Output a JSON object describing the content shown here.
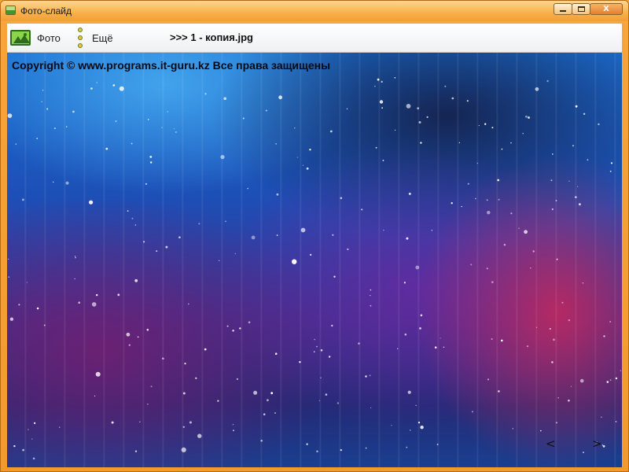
{
  "window": {
    "title": "Фото-слайд",
    "controls": {
      "close_label": "X"
    }
  },
  "toolbar": {
    "photo_label": "Фото",
    "more_label": "Ещё",
    "filename": ">>> 1 - копия.jpg"
  },
  "viewer": {
    "copyright": "Copyright © www.programs.it-guru.kz Все права защищены",
    "prev_label": "<",
    "next_label": ">"
  },
  "colors": {
    "frame": "#f29a2e",
    "photo_icon": "#8cd44a",
    "dots_icon": "#e6c93a"
  },
  "icons": {
    "app": "app-photo-icon",
    "photo": "photo-landscape-icon",
    "more": "vertical-dots-icon"
  }
}
